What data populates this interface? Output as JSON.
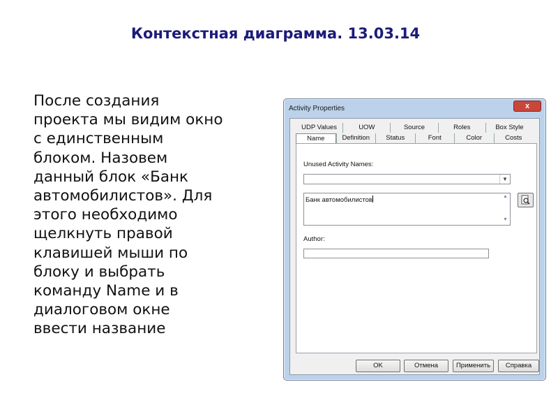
{
  "slide": {
    "title": "Контекстная диаграмма. 13.03.14",
    "body_lines": [
      "После создания",
      "проекта мы видим окно",
      "с единственным",
      "блоком. Назовем",
      "данный блок «Банк",
      "автомобилистов». Для",
      "этого необходимо",
      "щелкнуть правой",
      "клавишей мыши по",
      "блоку и выбрать",
      "команду Name и в",
      "диалоговом окне",
      "ввести название"
    ]
  },
  "dialog": {
    "title": "Activity Properties",
    "close_glyph": "x",
    "tabs_top": [
      "UDP Values",
      "UOW",
      "Source",
      "Roles",
      "Box Style"
    ],
    "tabs_bottom": [
      "Name",
      "Definition",
      "Status",
      "Font",
      "Color",
      "Costs"
    ],
    "active_tab": "Name",
    "unused_names_label": "Unused Activity Names:",
    "unused_names_value": "",
    "name_value": "Банк автомобилистов",
    "author_label": "Author:",
    "author_value": "",
    "buttons": {
      "ok": "OK",
      "cancel": "Отмена",
      "apply": "Применить",
      "help": "Справка"
    },
    "icons": {
      "browse": "magnifier-document-icon",
      "combo_arrow": "chevron-down-icon"
    }
  }
}
